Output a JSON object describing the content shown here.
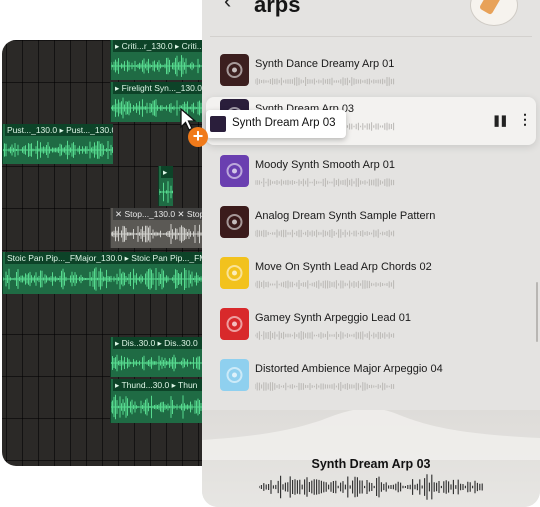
{
  "panel": {
    "back_glyph": "‹",
    "title": "arps",
    "rows": [
      {
        "name": "Synth Dance Dreamy Arp 01",
        "art_color": "#3c1f1f"
      },
      {
        "name": "Synth Dream Arp 03",
        "art_color": "#2a1e3b",
        "active": true
      },
      {
        "name": "Moody Synth Smooth Arp 01",
        "art_color": "#6a3fb0"
      },
      {
        "name": "Analog Dream Synth Sample Pattern",
        "art_color": "#3b1b1b"
      },
      {
        "name": "Move On Synth Lead Arp Chords 02",
        "art_color": "#f2c21d"
      },
      {
        "name": "Gamey Synth Arpeggio Lead 01",
        "art_color": "#d8292b"
      },
      {
        "name": "Distorted Ambience Major Arpeggio 04",
        "art_color": "#8fd0ef"
      }
    ],
    "pause_glyph": "❚❚",
    "more_glyph": "⋮"
  },
  "drag": {
    "ghost_name": "Synth Dream Arp 03",
    "plus_glyph": "+"
  },
  "player": {
    "now_playing": "Synth Dream Arp 03"
  },
  "daw": {
    "clips": [
      {
        "label": "▸ Criti...r_130.0 ▸ Criti..._130.0"
      },
      {
        "label": "▸ Firelight Syn..._130.0 ▸"
      },
      {
        "label": "Pust..._130.0 ▸ Pust..._130.0"
      },
      {
        "label": "▸"
      },
      {
        "label": "✕ Stop..._130.0 ✕ Stop..."
      },
      {
        "label": "Stoic Pan Pip..._FMajor_130.0 ▸ Stoic Pan Pip..._FMajo"
      },
      {
        "label": "▸ Dis..30.0 ▸ Dis..30.0"
      },
      {
        "label": "▸ Thund...30.0 ▸ Thun"
      }
    ]
  },
  "colors": {
    "clip_green": "#1f6b44",
    "wave_green": "#56d98e",
    "accent_orange": "#f07a1a"
  }
}
